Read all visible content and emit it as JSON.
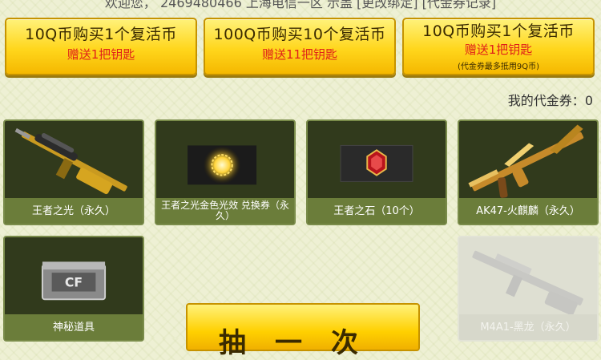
{
  "welcome_text": "欢迎您，  2469480466  上海电信一区 示盖 [更改绑定] [代金券记录]",
  "buy_buttons": [
    {
      "title": "10Q币购买1个复活币",
      "bonus": "赠送1把钥匙",
      "note": ""
    },
    {
      "title": "100Q币购买10个复活币",
      "bonus": "赠送11把钥匙",
      "note": ""
    },
    {
      "title": "10Q币购买1个复活币",
      "bonus": "赠送1把钥匙",
      "note": "(代金券最多抵用9Q币)"
    }
  ],
  "voucher": {
    "label": "我的代金券：",
    "value": "0"
  },
  "items": [
    {
      "name": "王者之光（永久）",
      "icon": "sniper-rifle-icon"
    },
    {
      "name": "王者之光金色光效 兑换券（永久）",
      "icon": "golden-glow-icon"
    },
    {
      "name": "王者之石（10个）",
      "icon": "red-gem-icon"
    },
    {
      "name": "AK47-火麒麟（永久）",
      "icon": "ak47-rifle-icon"
    },
    {
      "name": "神秘道具",
      "icon": "mystery-crate-icon"
    },
    {
      "name": "M4A1-黑龙（永久）",
      "icon": "m4a1-rifle-icon",
      "dimmed": true
    }
  ],
  "draw_button": {
    "label": "抽一次"
  },
  "colors": {
    "gold": "#ffd61c",
    "red": "#e0201a",
    "card": "#313a1c",
    "label": "#6b7d3a"
  }
}
